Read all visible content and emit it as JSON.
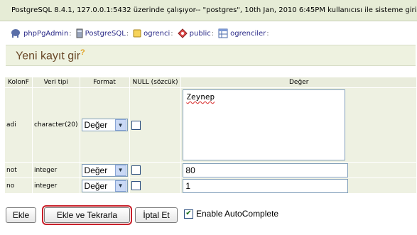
{
  "header": {
    "status_text": "PostgreSQL 8.4.1, 127.0.0.1:5432 üzerinde çalışıyor-- \"postgres\", 10th Jan, 2010 6:45PM kullanıcısı ile sisteme giriş yap"
  },
  "trail": [
    {
      "icon": "elephant-icon",
      "label": "phpPgAdmin"
    },
    {
      "icon": "server-icon",
      "label": "PostgreSQL"
    },
    {
      "icon": "database-icon",
      "label": "ogrenci"
    },
    {
      "icon": "schema-icon",
      "label": "public"
    },
    {
      "icon": "table-icon",
      "label": "ogrenciler"
    }
  ],
  "trail_suffix": ":",
  "page": {
    "title": "Yeni kayıt gir",
    "help_mark": "?"
  },
  "table": {
    "headers": [
      "KolonF",
      "Veri tipi",
      "Format",
      "NULL (sözcük)",
      "Değer"
    ],
    "rows": [
      {
        "column": "adi",
        "type": "character(20)",
        "format": "Değer",
        "value": "Zeynep"
      },
      {
        "column": "not",
        "type": "integer",
        "format": "Değer",
        "value": "80"
      },
      {
        "column": "no",
        "type": "integer",
        "format": "Değer",
        "value": "1"
      }
    ]
  },
  "actions": {
    "insert_label": "Ekle",
    "insert_repeat_label": "Ekle ve Tekrarla",
    "cancel_label": "İptal Et",
    "autocomplete_label": "Enable AutoComplete",
    "autocomplete_checked": true
  },
  "colors": {
    "topbar_bg": "#e6ecd6",
    "title_color": "#6b4a2a",
    "highlight": "#c8202a"
  }
}
